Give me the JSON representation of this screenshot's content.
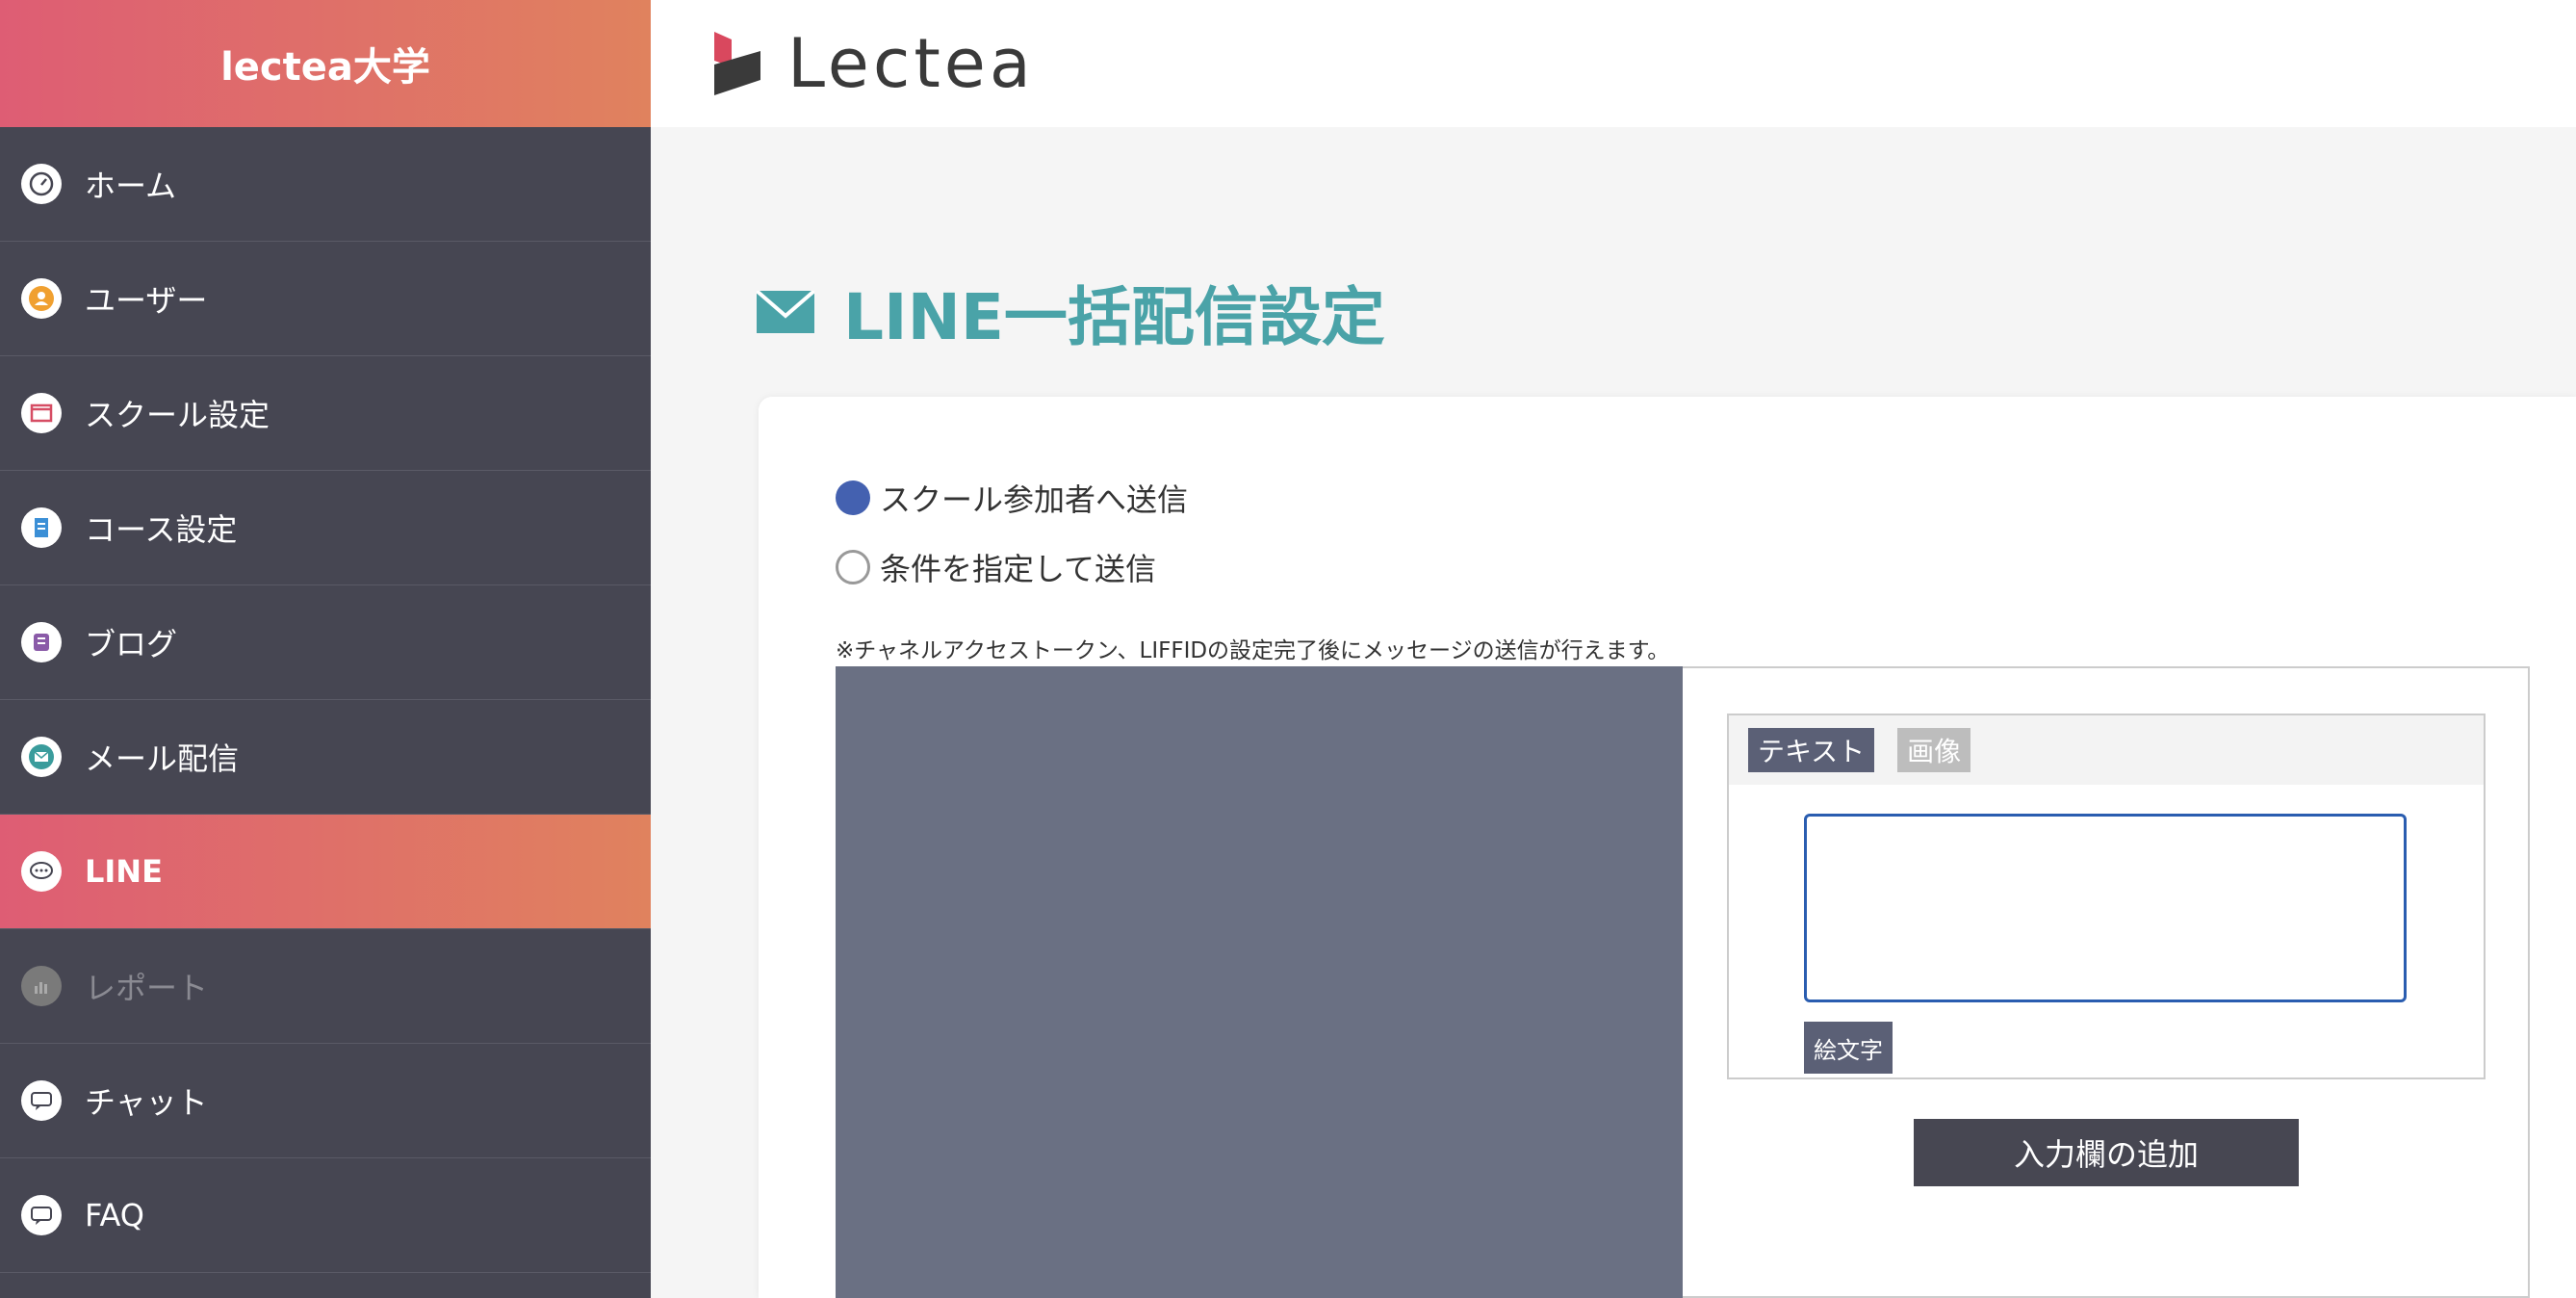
{
  "sidebar": {
    "brand": "lectea大学",
    "items": [
      {
        "label": "ホーム",
        "icon": "dashboard-icon",
        "state": "normal"
      },
      {
        "label": "ユーザー",
        "icon": "user-icon",
        "state": "normal"
      },
      {
        "label": "スクール設定",
        "icon": "window-icon",
        "state": "normal"
      },
      {
        "label": "コース設定",
        "icon": "document-icon",
        "state": "normal"
      },
      {
        "label": "ブログ",
        "icon": "blog-icon",
        "state": "normal"
      },
      {
        "label": "メール配信",
        "icon": "mail-icon",
        "state": "normal"
      },
      {
        "label": "LINE",
        "icon": "chat-bubble-icon",
        "state": "active"
      },
      {
        "label": "レポート",
        "icon": "report-icon",
        "state": "disabled"
      },
      {
        "label": "チャット",
        "icon": "faq-bubble-icon",
        "state": "normal"
      },
      {
        "label": "FAQ",
        "icon": "faq-bubble-icon",
        "state": "normal"
      }
    ]
  },
  "header": {
    "logo_text": "Lectea"
  },
  "main": {
    "title": "LINE一括配信設定",
    "radio_options": [
      {
        "label": "スクール参加者へ送信",
        "checked": true
      },
      {
        "label": "条件を指定して送信",
        "checked": false
      }
    ],
    "note": "※チャネルアクセストークン、LIFFIDの設定完了後にメッセージの送信が行えます。",
    "tabs": [
      "テキスト",
      "画像"
    ],
    "emoji_button": "絵文字",
    "add_field_button": "入力欄の追加"
  },
  "colors": {
    "accent_gradient": [
      "#de5d74",
      "#e0825e"
    ],
    "sidebar_bg": "#464652",
    "title_teal": "#4aa3a8",
    "radio_checked": "#4461b0",
    "preview_bg": "#6a7083"
  }
}
